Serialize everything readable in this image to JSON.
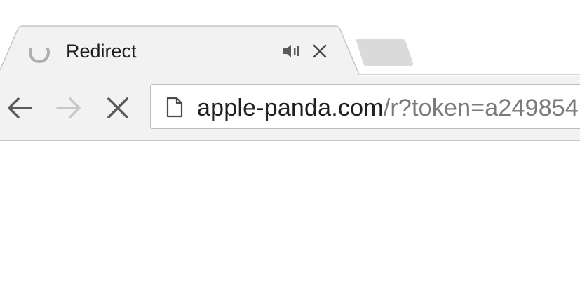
{
  "tab": {
    "title": "Redirect",
    "loading": true,
    "audio_playing": true,
    "spinner_icon": "loading-spinner-icon",
    "audio_icon": "speaker-icon",
    "close_icon": "close-icon"
  },
  "toolbar": {
    "back_icon": "arrow-left-icon",
    "forward_icon": "arrow-right-icon",
    "stop_icon": "stop-x-icon",
    "forward_enabled": false
  },
  "omnibox": {
    "page_icon": "document-icon",
    "url_host": "apple-panda.com",
    "url_path": "/r?token=a249854"
  },
  "colors": {
    "tab_bg": "#f2f2f2",
    "tab_border": "#c6c6c6",
    "inactive_tab": "#dadada",
    "icon_active": "#5a5a5a",
    "icon_disabled": "#c8c8c8",
    "url_host": "#1f1f1f",
    "url_path": "#7a7a7a"
  }
}
